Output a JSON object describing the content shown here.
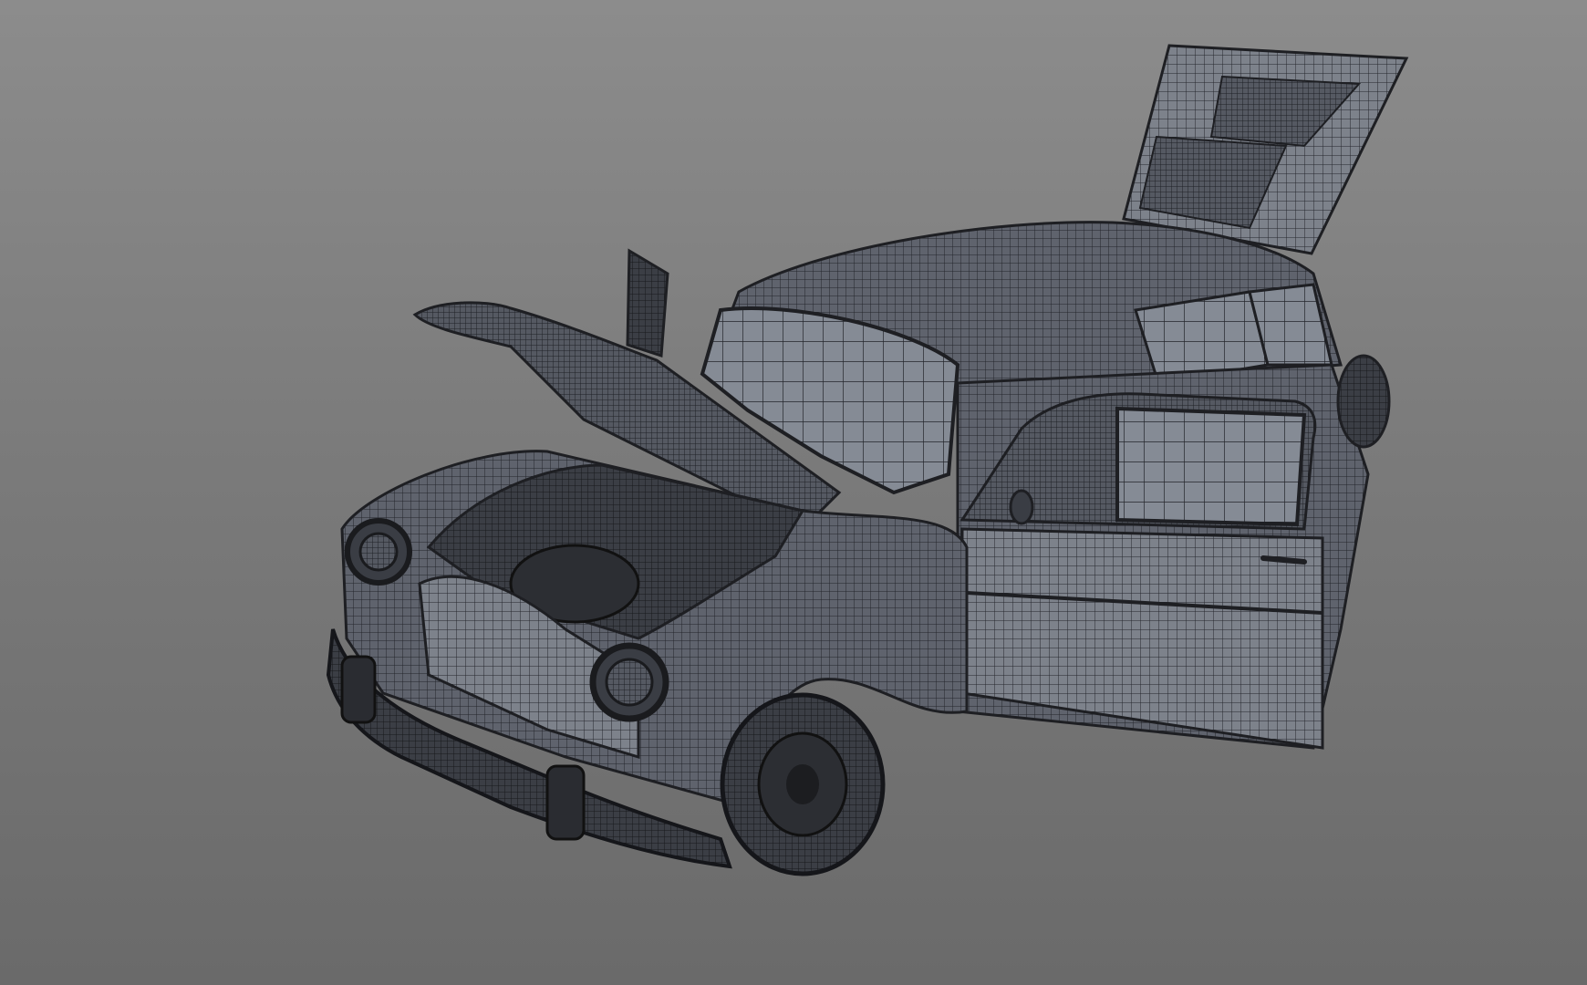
{
  "viewport": {
    "background_top": "#8c8c8c",
    "background_bottom": "#6a6a6a",
    "model_color": "#5e626c",
    "wire_color": "#1e1f23",
    "glass_color": "#8b9099"
  },
  "model": {
    "object": "car-wireframe-mesh",
    "parts": [
      "body",
      "roof",
      "hood",
      "trunk-lid",
      "door",
      "front-wheel",
      "front-bumper",
      "headlight-left",
      "headlight-right",
      "engine-bay",
      "windshield"
    ]
  }
}
